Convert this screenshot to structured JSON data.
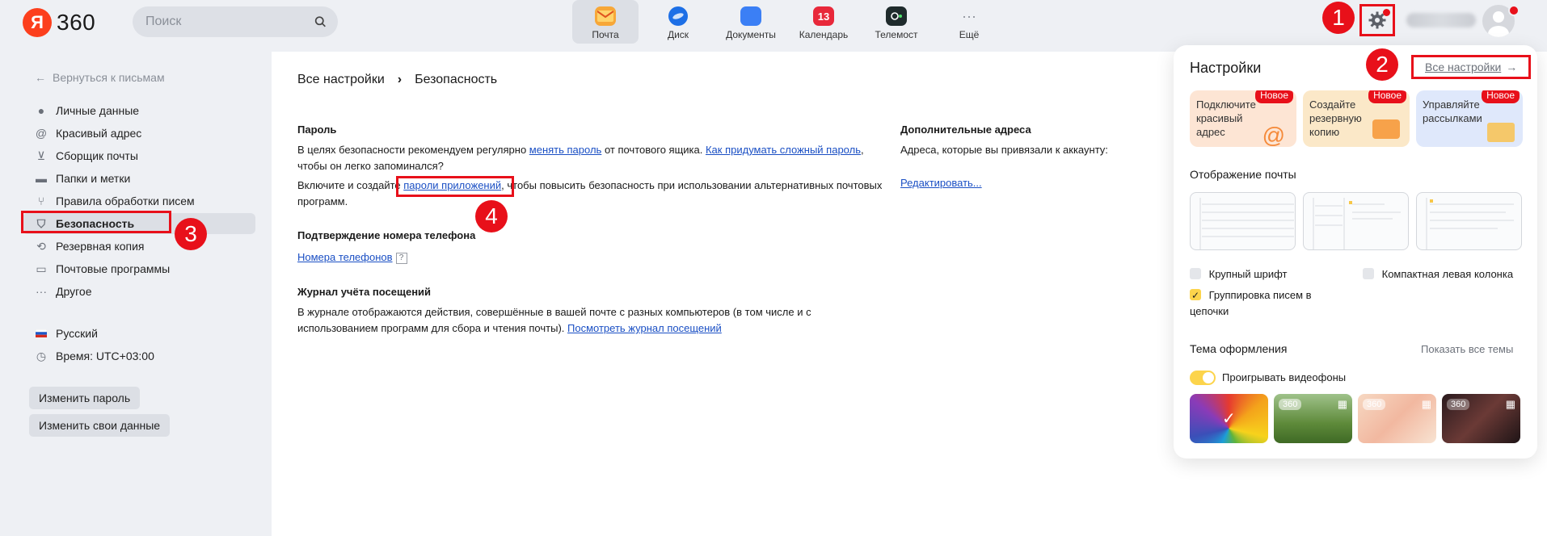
{
  "header": {
    "logo_letter": "Я",
    "logo_text": "360",
    "search_placeholder": "Поиск",
    "apps": [
      {
        "label": "Почта",
        "icon": "mail-icon",
        "color": "#f7a738",
        "active": true
      },
      {
        "label": "Диск",
        "icon": "disk-icon",
        "color": "#1d6fe6"
      },
      {
        "label": "Документы",
        "icon": "documents-icon",
        "color": "#3b7ff5"
      },
      {
        "label": "Календарь",
        "icon": "calendar-icon",
        "color": "#e8283a",
        "badge": "13"
      },
      {
        "label": "Телемост",
        "icon": "telemost-icon",
        "color": "#1f2b2c"
      },
      {
        "label": "Ещё",
        "icon": "more-icon"
      }
    ]
  },
  "markers": [
    "1",
    "2",
    "3",
    "4"
  ],
  "sidebar": {
    "back_label": "Вернуться к письмам",
    "items": [
      {
        "label": "Личные данные",
        "icon": "user-icon"
      },
      {
        "label": "Красивый адрес",
        "icon": "at-icon"
      },
      {
        "label": "Сборщик почты",
        "icon": "collector-icon"
      },
      {
        "label": "Папки и метки",
        "icon": "folder-icon"
      },
      {
        "label": "Правила обработки писем",
        "icon": "rules-icon"
      },
      {
        "label": "Безопасность",
        "icon": "shield-icon",
        "active": true
      },
      {
        "label": "Резервная копия",
        "icon": "backup-icon"
      },
      {
        "label": "Почтовые программы",
        "icon": "mail-programs-icon"
      },
      {
        "label": "Другое",
        "icon": "more-dots-icon"
      }
    ],
    "language": "Русский",
    "time": "Время: UTC+03:00",
    "buttons": [
      "Изменить пароль",
      "Изменить свои данные"
    ]
  },
  "main": {
    "breadcrumb_root": "Все настройки",
    "breadcrumb_sep": "›",
    "breadcrumb_current": "Безопасность",
    "password": {
      "title": "Пароль",
      "p1_a": "В целях безопасности рекомендуем регулярно ",
      "p1_link1": "менять пароль",
      "p1_b": " от почтового ящика. ",
      "p1_link2": "Как придумать сложный пароль",
      "p1_c": ",",
      "p1_d": "чтобы он легко запоминался?",
      "p2_a": "Включите и создайте ",
      "p2_link": "пароли приложений",
      "p2_b": ", чтобы повысить безопасность при использовании альтернативных почтовых",
      "p2_c": "программ."
    },
    "phone": {
      "title": "Подтверждение номера телефона",
      "link": "Номера телефонов",
      "help": "?"
    },
    "log": {
      "title": "Журнал учёта посещений",
      "line1": "В журнале отображаются действия, совершённые в вашей почте с разных компьютеров (в том числе и с",
      "line2": "использованием программ для сбора и чтения почты). ",
      "link": "Посмотреть журнал посещений"
    },
    "extra": {
      "title": "Дополнительные адреса",
      "text": "Адреса, которые вы привязали к аккаунту:",
      "link": "Редактировать..."
    }
  },
  "panel": {
    "title": "Настройки",
    "all_settings": "Все настройки",
    "cards": [
      {
        "text": "Подключите красивый адрес",
        "badge": "Новое",
        "bg": "#fde5d4"
      },
      {
        "text": "Создайте резервную копию",
        "badge": "Новое",
        "bg": "#fbe8c8"
      },
      {
        "text": "Управляйте рассылками",
        "badge": "Новое",
        "bg": "#dfe8fb"
      }
    ],
    "display_title": "Отображение почты",
    "opt_large_font": "Крупный шрифт",
    "opt_compact": "Компактная левая колонка",
    "opt_grouping": "Группировка писем в цепочки",
    "theme_title": "Тема оформления",
    "show_all_themes": "Показать все темы",
    "video_bg": "Проигрывать видеофоны",
    "theme_badge": "360"
  }
}
